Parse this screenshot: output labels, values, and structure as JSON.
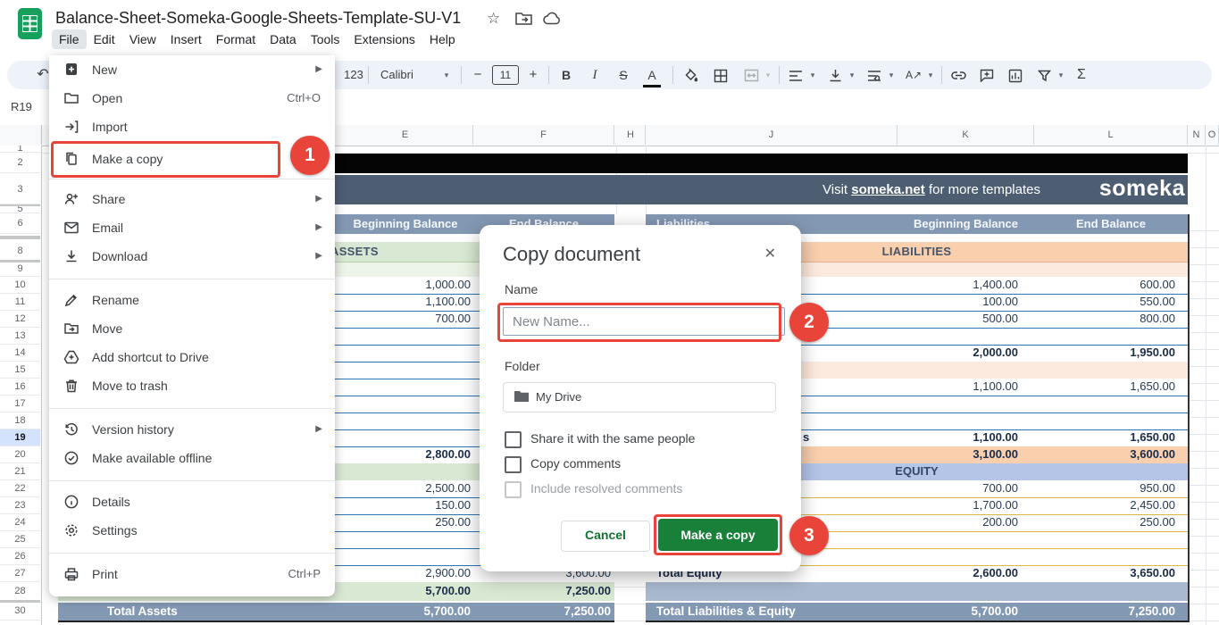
{
  "app": {
    "title": "Balance-Sheet-Someka-Google-Sheets-Template-SU-V1",
    "menu": [
      "File",
      "Edit",
      "View",
      "Insert",
      "Format",
      "Data",
      "Tools",
      "Extensions",
      "Help"
    ],
    "active_menu": "File",
    "name_box": "R19",
    "toolbar": {
      "number_format": "123",
      "font": "Calibri",
      "font_size": "11"
    }
  },
  "glyphs": {
    "undo": "↶",
    "caret": "▾",
    "minus": "−",
    "plus": "+",
    "bold": "B",
    "italic": "I",
    "strike": "S",
    "text_color": "A",
    "sum": "Σ",
    "star": "☆",
    "close": "✕",
    "rotate": "A↗"
  },
  "file_menu": {
    "items": [
      {
        "label": "New",
        "submenu": true
      },
      {
        "label": "Open",
        "shortcut": "Ctrl+O"
      },
      {
        "label": "Import"
      },
      {
        "label": "Make a copy",
        "highlighted": true
      },
      {
        "label": "Share",
        "submenu": true
      },
      {
        "label": "Email",
        "submenu": true
      },
      {
        "label": "Download",
        "submenu": true
      },
      {
        "label": "Rename"
      },
      {
        "label": "Move"
      },
      {
        "label": "Add shortcut to Drive"
      },
      {
        "label": "Move to trash"
      },
      {
        "label": "Version history",
        "submenu": true
      },
      {
        "label": "Make available offline"
      },
      {
        "label": "Details"
      },
      {
        "label": "Settings"
      },
      {
        "label": "Print",
        "shortcut": "Ctrl+P"
      }
    ]
  },
  "dialog": {
    "title": "Copy document",
    "name_label": "Name",
    "name_placeholder": "New Name...",
    "folder_label": "Folder",
    "folder_value": "My Drive",
    "checkboxes": [
      {
        "label": "Share it with the same people",
        "disabled": false
      },
      {
        "label": "Copy comments",
        "disabled": false
      },
      {
        "label": "Include resolved comments",
        "disabled": true
      }
    ],
    "cancel_label": "Cancel",
    "confirm_label": "Make a copy"
  },
  "annotations": {
    "color": "#e8443a",
    "steps": [
      "1",
      "2",
      "3"
    ]
  },
  "sheet": {
    "columns": [
      "E",
      "F",
      "H",
      "J",
      "K",
      "L",
      "N",
      "O"
    ],
    "row_numbers": [
      "1",
      "2",
      "3",
      "5",
      "6",
      "8",
      "9",
      "10",
      "11",
      "12",
      "13",
      "14",
      "15",
      "16",
      "17",
      "18",
      "19",
      "20",
      "21",
      "22",
      "23",
      "24",
      "25",
      "26",
      "27",
      "28",
      "30"
    ],
    "selected_row": "19",
    "banner": {
      "prefix": "Visit ",
      "link": "someka.net",
      "suffix": " for more templates",
      "logo": "someka"
    },
    "left": {
      "header_col1": "Beginning Balance",
      "header_col2": "End Balance",
      "section": "ASSETS",
      "rows": [
        {
          "n": 10,
          "v1": "1,000.00"
        },
        {
          "n": 11,
          "v1": "1,100.00"
        },
        {
          "n": 12,
          "v1": "700.00"
        },
        {
          "n": 13
        },
        {
          "n": 14
        },
        {
          "n": 15
        },
        {
          "n": 16
        },
        {
          "n": 17
        },
        {
          "n": 18
        },
        {
          "n": 19
        },
        {
          "n": 20,
          "v1": "2,800.00",
          "bold": true
        },
        {
          "n": 21,
          "band": "green",
          "noline": true
        },
        {
          "n": 22,
          "v1": "2,500.00"
        },
        {
          "n": 23,
          "v1": "150.00"
        },
        {
          "n": 24,
          "v1": "250.00"
        },
        {
          "n": 25
        },
        {
          "n": 26
        },
        {
          "n": 27,
          "v1": "2,900.00",
          "v2": "3,600.00"
        },
        {
          "n": 28,
          "band": "green",
          "v1": "5,700.00",
          "v2": "7,250.00",
          "bold": true,
          "noline": true
        }
      ],
      "total": {
        "label": "Total Assets",
        "v1": "5,700.00",
        "v2": "7,250.00"
      }
    },
    "right": {
      "header_col1": "Beginning Balance",
      "header_col2": "End Balance",
      "header_side_label": "Liabilities",
      "section": "LIABILITIES",
      "rows": [
        {
          "n": 10,
          "v1": "1,400.00",
          "v2": "600.00"
        },
        {
          "n": 11,
          "v1": "100.00",
          "v2": "550.00"
        },
        {
          "n": 12,
          "v1": "500.00",
          "v2": "800.00"
        },
        {
          "n": 13
        },
        {
          "n": 14,
          "v1": "2,000.00",
          "v2": "1,950.00",
          "bold": true
        },
        {
          "n": 15,
          "band": "peachlight",
          "noline": true
        },
        {
          "n": 16,
          "v1": "1,100.00",
          "v2": "1,650.00"
        },
        {
          "n": 17
        },
        {
          "n": 18
        },
        {
          "n": 19,
          "label": "s",
          "v1": "1,100.00",
          "v2": "1,650.00",
          "bold": true
        },
        {
          "n": 20,
          "band": "peach",
          "v1": "3,100.00",
          "v2": "3,600.00",
          "bold": true,
          "noline": true
        },
        {
          "n": 21,
          "band": "equity",
          "center": "EQUITY",
          "noline": true
        },
        {
          "n": 22,
          "v1": "700.00",
          "v2": "950.00",
          "line": "yellow"
        },
        {
          "n": 23,
          "v1": "1,700.00",
          "v2": "2,450.00",
          "line": "yellow"
        },
        {
          "n": 24,
          "v1": "200.00",
          "v2": "250.00",
          "line": "yellow"
        },
        {
          "n": 25,
          "line": "yellow"
        },
        {
          "n": 26,
          "line": "yellow"
        },
        {
          "n": 27,
          "label": "Total Equity",
          "v1": "2,600.00",
          "v2": "3,650.00",
          "bold": true,
          "line": "yellow"
        },
        {
          "n": 28,
          "band": "bluelight",
          "noline": true
        }
      ],
      "total": {
        "label": "Total Liabilities & Equity",
        "v1": "5,700.00",
        "v2": "7,250.00"
      }
    },
    "colors": {
      "band_header": "#8398b3",
      "banner_slate": "#4d5e73",
      "black_band": "#050505",
      "green": "#d9e8d3",
      "green_light": "#ecf4e7",
      "peach": "#f9cfad",
      "peach_light": "#fdeade",
      "equity": "#b4c5e8",
      "bluegray_light": "#a9bacf",
      "line_blue": "#2e74b5",
      "line_yellow": "#ddb942",
      "confirm_green": "#188038",
      "annotation_red": "#e8443a"
    }
  }
}
